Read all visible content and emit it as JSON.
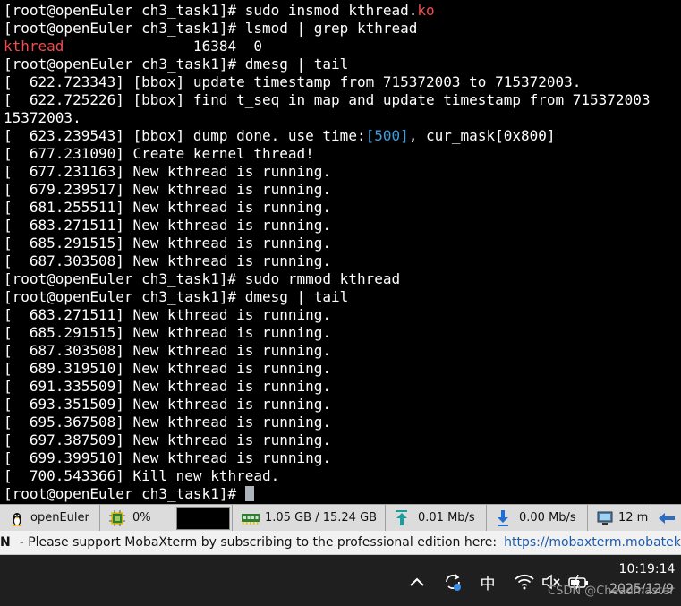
{
  "terminal": {
    "lines": [
      [
        {
          "t": "[root@openEuler ch3_task1]# sudo insmod kthread."
        },
        {
          "t": "ko",
          "c": "red"
        }
      ],
      [
        {
          "t": "[root@openEuler ch3_task1]# lsmod | grep kthread"
        }
      ],
      [
        {
          "t": "kthread",
          "c": "red"
        },
        {
          "t": "               16384  0"
        }
      ],
      [
        {
          "t": "[root@openEuler ch3_task1]# dmesg | tail"
        }
      ],
      [
        {
          "t": "[  622.723343] [bbox] update timestamp from 715372003 to 715372003."
        }
      ],
      [
        {
          "t": "[  622.725226] [bbox] find t_seq in map and update timestamp from 715372003"
        }
      ],
      [
        {
          "t": "15372003."
        }
      ],
      [
        {
          "t": "[  623.239543] [bbox] dump done. use time:"
        },
        {
          "t": "[500]",
          "c": "cyan"
        },
        {
          "t": ", cur_mask[0x800]"
        }
      ],
      [
        {
          "t": "[  677.231090] Create kernel thread!"
        }
      ],
      [
        {
          "t": "[  677.231163] New kthread is running."
        }
      ],
      [
        {
          "t": "[  679.239517] New kthread is running."
        }
      ],
      [
        {
          "t": "[  681.255511] New kthread is running."
        }
      ],
      [
        {
          "t": "[  683.271511] New kthread is running."
        }
      ],
      [
        {
          "t": "[  685.291515] New kthread is running."
        }
      ],
      [
        {
          "t": "[  687.303508] New kthread is running."
        }
      ],
      [
        {
          "t": "[root@openEuler ch3_task1]# sudo rmmod kthread"
        }
      ],
      [
        {
          "t": "[root@openEuler ch3_task1]# dmesg | tail"
        }
      ],
      [
        {
          "t": "[  683.271511] New kthread is running."
        }
      ],
      [
        {
          "t": "[  685.291515] New kthread is running."
        }
      ],
      [
        {
          "t": "[  687.303508] New kthread is running."
        }
      ],
      [
        {
          "t": "[  689.319510] New kthread is running."
        }
      ],
      [
        {
          "t": "[  691.335509] New kthread is running."
        }
      ],
      [
        {
          "t": "[  693.351509] New kthread is running."
        }
      ],
      [
        {
          "t": "[  695.367508] New kthread is running."
        }
      ],
      [
        {
          "t": "[  697.387509] New kthread is running."
        }
      ],
      [
        {
          "t": "[  699.399510] New kthread is running."
        }
      ],
      [
        {
          "t": "[  700.543366] Kill new kthread."
        }
      ],
      [
        {
          "t": "[root@openEuler ch3_task1]# "
        }
      ]
    ]
  },
  "colors": {
    "red": "#f14c4c",
    "cyan": "#3c9ee0",
    "link": "#1c5aa8"
  },
  "statusbar": {
    "host": "openEuler",
    "cpu": "0%",
    "memory": "1.05 GB / 15.24 GB",
    "upload": "0.01 Mb/s",
    "download": "0.00 Mb/s",
    "uptime": "12 m"
  },
  "notice": {
    "prefix": "N",
    "text": "-  Please support MobaXterm by subscribing to the professional edition here:",
    "link": "https://mobaxterm.mobatek.net"
  },
  "taskbar": {
    "ime": "中",
    "time": "10:19:14",
    "date": "2025/12/9",
    "watermark": "CSDN @Cheadmaster"
  }
}
